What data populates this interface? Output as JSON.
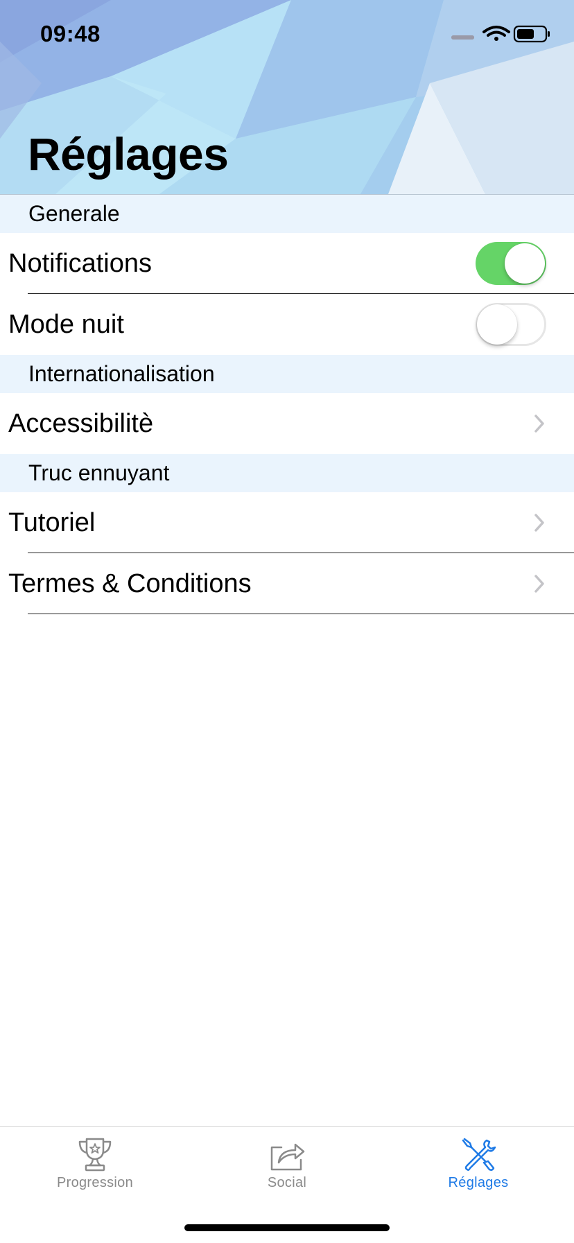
{
  "status_bar": {
    "time": "09:48"
  },
  "header": {
    "title": "Réglages"
  },
  "sections": [
    {
      "header": "Generale",
      "rows": [
        {
          "label": "Notifications",
          "control": "toggle",
          "toggle_on": true
        },
        {
          "label": "Mode nuit",
          "control": "toggle",
          "toggle_on": false
        }
      ]
    },
    {
      "header": "Internationalisation",
      "rows": [
        {
          "label": "Accessibilitè",
          "control": "chevron-right-icon"
        }
      ]
    },
    {
      "header": "Truc ennuyant",
      "rows": [
        {
          "label": "Tutoriel",
          "control": "chevron-right-icon"
        },
        {
          "label": "Termes & Conditions",
          "control": "chevron-right-icon"
        }
      ]
    }
  ],
  "tab_bar": {
    "tabs": [
      {
        "label": "Progression",
        "icon": "trophy-icon",
        "selected": false
      },
      {
        "label": "Social",
        "icon": "share-icon",
        "selected": false
      },
      {
        "label": "Réglages",
        "icon": "tools-icon",
        "selected": true
      }
    ]
  },
  "colors": {
    "toggle_on": "#65d467",
    "section_header_bg": "#eaf4fd",
    "tab_active": "#1e7ae6",
    "tab_inactive": "#8a8a8a"
  }
}
